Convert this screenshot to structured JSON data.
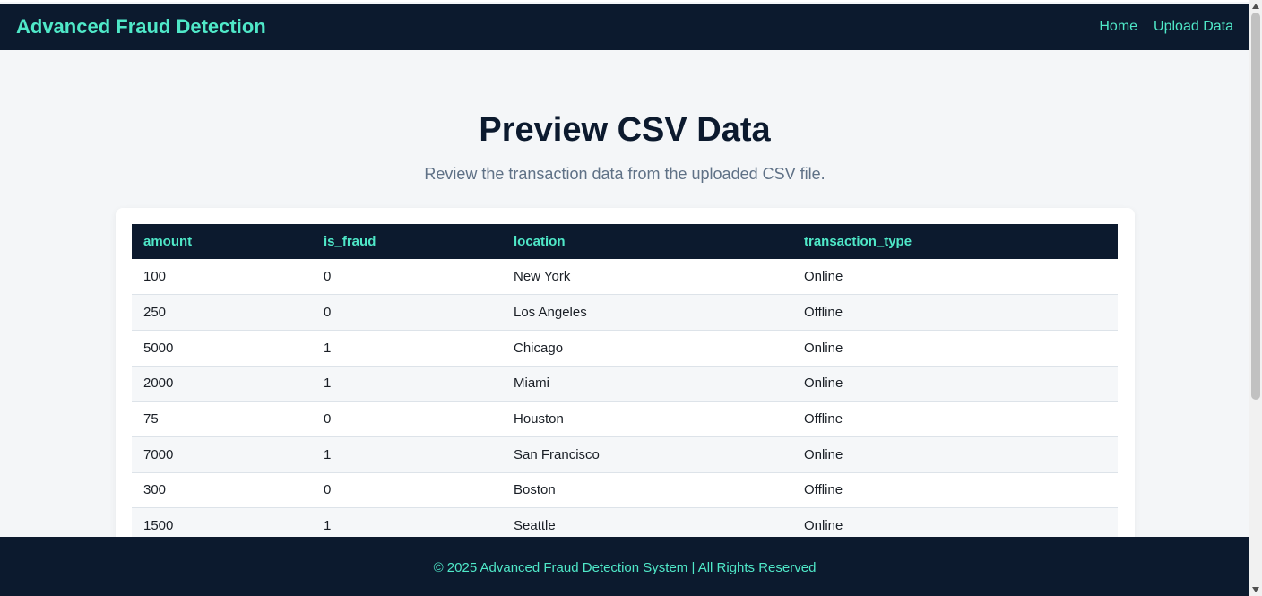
{
  "navbar": {
    "brand": "Advanced Fraud Detection",
    "links": [
      "Home",
      "Upload Data"
    ]
  },
  "main": {
    "title": "Preview CSV Data",
    "subtitle": "Review the transaction data from the uploaded CSV file."
  },
  "table": {
    "headers": [
      "amount",
      "is_fraud",
      "location",
      "transaction_type"
    ],
    "rows": [
      [
        "100",
        "0",
        "New York",
        "Online"
      ],
      [
        "250",
        "0",
        "Los Angeles",
        "Offline"
      ],
      [
        "5000",
        "1",
        "Chicago",
        "Online"
      ],
      [
        "2000",
        "1",
        "Miami",
        "Online"
      ],
      [
        "75",
        "0",
        "Houston",
        "Offline"
      ],
      [
        "7000",
        "1",
        "San Francisco",
        "Online"
      ],
      [
        "300",
        "0",
        "Boston",
        "Offline"
      ],
      [
        "1500",
        "1",
        "Seattle",
        "Online"
      ]
    ]
  },
  "footer": {
    "text": "© 2025 Advanced Fraud Detection System | All Rights Reserved"
  },
  "colors": {
    "navy": "#0c1a2e",
    "accent": "#4fe8c8"
  }
}
